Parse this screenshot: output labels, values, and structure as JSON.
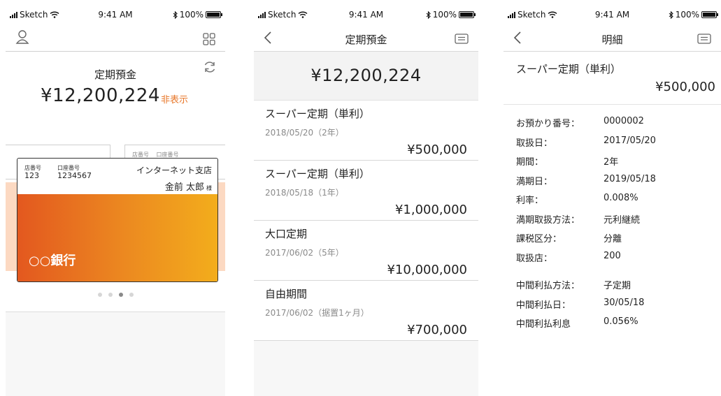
{
  "status": {
    "carrier": "Sketch",
    "time": "9:41 AM",
    "battery": "100%"
  },
  "screen1": {
    "section_title": "定期預金",
    "total_amount": "¥12,200,224",
    "hide_label": "非表示",
    "back_card": {
      "branch_no_label": "店番号",
      "account_no_label": "口座番号"
    },
    "card": {
      "branch_no_label": "店番号",
      "branch_no": "123",
      "account_no_label": "口座番号",
      "account_no": "1234567",
      "branch_name": "インターネット支店",
      "owner_name": "金前 太郎",
      "owner_suffix": "様",
      "bank_name": "○○銀行",
      "gradient": [
        "#e3581f",
        "#ec8a20",
        "#f3ad1c"
      ]
    },
    "pager": {
      "count": 4,
      "active": 2
    }
  },
  "screen2": {
    "title": "定期預金",
    "total_amount": "¥12,200,224",
    "deposits": [
      {
        "name": "スーパー定期（単利）",
        "date": "2018/05/20（2年）",
        "amount": "¥500,000"
      },
      {
        "name": "スーパー定期（単利）",
        "date": "2018/05/18（1年）",
        "amount": "¥1,000,000"
      },
      {
        "name": "大口定期",
        "date": "2017/06/02（5年）",
        "amount": "¥10,000,000"
      },
      {
        "name": "自由期間",
        "date": "2017/06/02（据置1ヶ月）",
        "amount": "¥700,000"
      }
    ]
  },
  "screen3": {
    "title": "明細",
    "product_name": "スーパー定期（単利）",
    "amount": "¥500,000",
    "details": [
      {
        "label": "お預かり番号：",
        "value": "0000002"
      },
      {
        "label": "取扱日：",
        "value": "2017/05/20"
      },
      {
        "label": "期間：",
        "value": "2年"
      },
      {
        "label": "満期日：",
        "value": "2019/05/18"
      },
      {
        "label": "利率：",
        "value": "0.008%"
      },
      {
        "label": "満期取扱方法：",
        "value": "元利継続"
      },
      {
        "label": "課税区分：",
        "value": "分離"
      },
      {
        "label": "取扱店：",
        "value": "200"
      }
    ],
    "interest_details": [
      {
        "label": "中間利払方法：",
        "value": "子定期"
      },
      {
        "label": "中間利払日：",
        "value": "30/05/18"
      },
      {
        "label": "中間利払利息",
        "value": "0.056%"
      }
    ]
  },
  "colors": {
    "accent": "#e8772a",
    "peach": "#fcd9c2",
    "divider": "#d8d8d8"
  },
  "icons": {
    "user": "user-icon",
    "grid": "grid-menu-icon",
    "refresh": "refresh-icon",
    "back": "chevron-left-icon",
    "menu": "list-menu-icon",
    "signal": "signal-icon",
    "wifi": "wifi-icon",
    "bluetooth": "bluetooth-icon",
    "battery": "battery-icon"
  }
}
